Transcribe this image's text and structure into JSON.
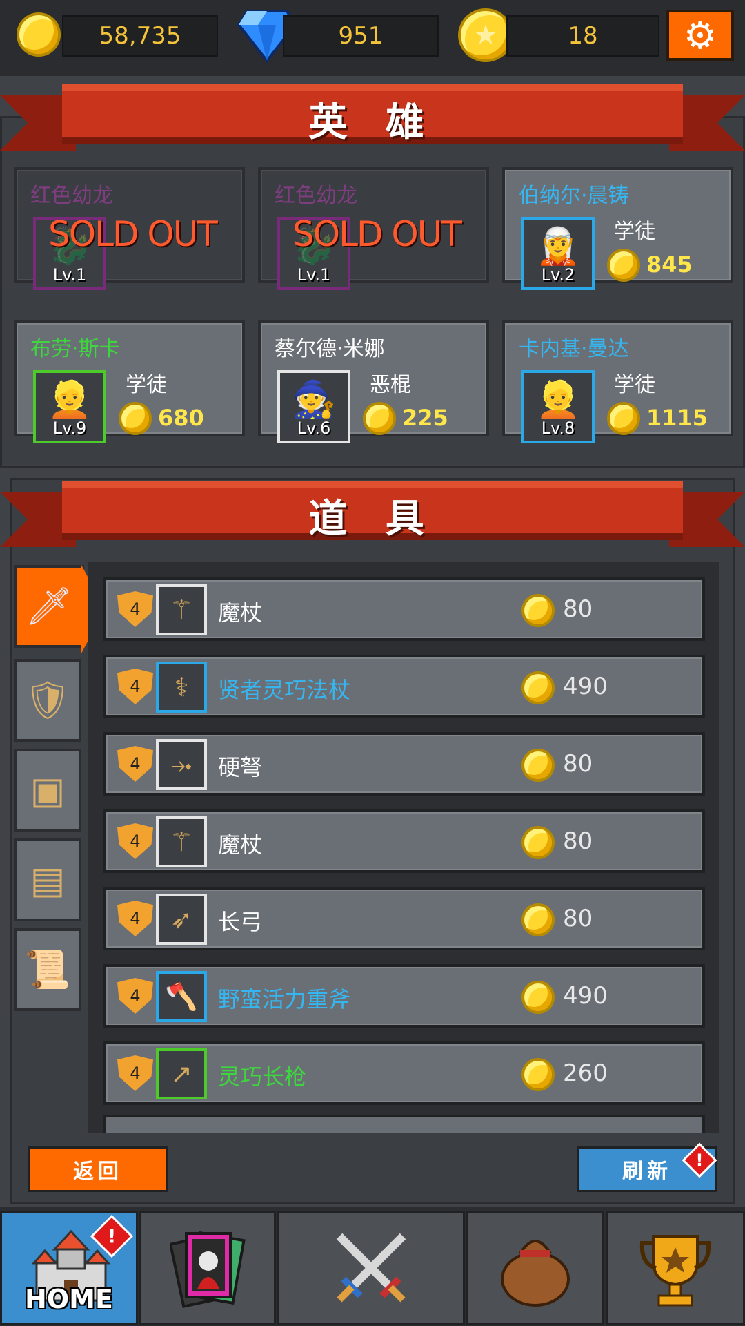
{
  "currency": {
    "gold": "58,735",
    "diamonds": "951",
    "stars": "18"
  },
  "heroes_section": {
    "title": "英 雄",
    "cards": [
      {
        "name": "红色幼龙",
        "name_color": "#8a3d8a",
        "level": "Lv.1",
        "sold_out": true,
        "sold_label": "SOLD OUT",
        "frame": "#7a2a7a",
        "icon": "dragon-icon"
      },
      {
        "name": "红色幼龙",
        "name_color": "#8a3d8a",
        "level": "Lv.1",
        "sold_out": true,
        "sold_label": "SOLD OUT",
        "frame": "#7a2a7a",
        "icon": "dragon-icon"
      },
      {
        "name": "伯纳尔·晨铸",
        "name_color": "#36b6f0",
        "level": "Lv.2",
        "class": "学徒",
        "price": "845",
        "frame": "#2aa8e8",
        "icon": "hero-teal-hair-icon"
      },
      {
        "name": "布劳·斯卡",
        "name_color": "#3ed63e",
        "level": "Lv.9",
        "class": "学徒",
        "price": "680",
        "frame": "#4ccb2a",
        "icon": "hero-blonde-icon"
      },
      {
        "name": "蔡尔德·米娜",
        "name_color": "#ffffff",
        "level": "Lv.6",
        "class": "恶棍",
        "price": "225",
        "frame": "#e5e5e5",
        "icon": "hero-purple-hair-icon"
      },
      {
        "name": "卡内基·曼达",
        "name_color": "#36b6f0",
        "level": "Lv.8",
        "class": "学徒",
        "price": "1115",
        "frame": "#2aa8e8",
        "icon": "hero-blonde-icon"
      }
    ]
  },
  "items_section": {
    "title": "道 具",
    "tabs": [
      {
        "icon": "sword-icon",
        "active": true
      },
      {
        "icon": "shield-icon",
        "active": false
      },
      {
        "icon": "armor-chest-icon",
        "active": false
      },
      {
        "icon": "treasure-chest-icon",
        "active": false
      },
      {
        "icon": "scroll-icon",
        "active": false
      }
    ],
    "items": [
      {
        "tier": "4",
        "name": "魔杖",
        "name_color": "#ffffff",
        "frame": "#e5e5e5",
        "icon": "wand-icon",
        "price": "80"
      },
      {
        "tier": "4",
        "name": "贤者灵巧法杖",
        "name_color": "#36b6f0",
        "frame": "#2aa8e8",
        "icon": "staff-icon",
        "price": "490"
      },
      {
        "tier": "4",
        "name": "硬弩",
        "name_color": "#ffffff",
        "frame": "#e5e5e5",
        "icon": "crossbow-icon",
        "price": "80"
      },
      {
        "tier": "4",
        "name": "魔杖",
        "name_color": "#ffffff",
        "frame": "#e5e5e5",
        "icon": "wand-icon",
        "price": "80"
      },
      {
        "tier": "4",
        "name": "长弓",
        "name_color": "#ffffff",
        "frame": "#e5e5e5",
        "icon": "longbow-icon",
        "price": "80"
      },
      {
        "tier": "4",
        "name": "野蛮活力重斧",
        "name_color": "#36b6f0",
        "frame": "#2aa8e8",
        "icon": "axe-icon",
        "price": "490"
      },
      {
        "tier": "4",
        "name": "灵巧长枪",
        "name_color": "#3ed63e",
        "frame": "#4ccb2a",
        "icon": "spear-icon",
        "price": "260"
      }
    ]
  },
  "buttons": {
    "back": "返回",
    "refresh": "刷新"
  },
  "alert_mark": "!",
  "navbar": {
    "home_label": "HOME",
    "items": [
      "castle-icon",
      "cards-icon",
      "crossed-swords-icon",
      "loot-bag-icon",
      "trophy-icon"
    ]
  },
  "colors": {
    "accent": "#ff6a00",
    "blue": "#3b8fce",
    "ribbon": "#c8341c",
    "gold_text": "#ffe64a"
  }
}
